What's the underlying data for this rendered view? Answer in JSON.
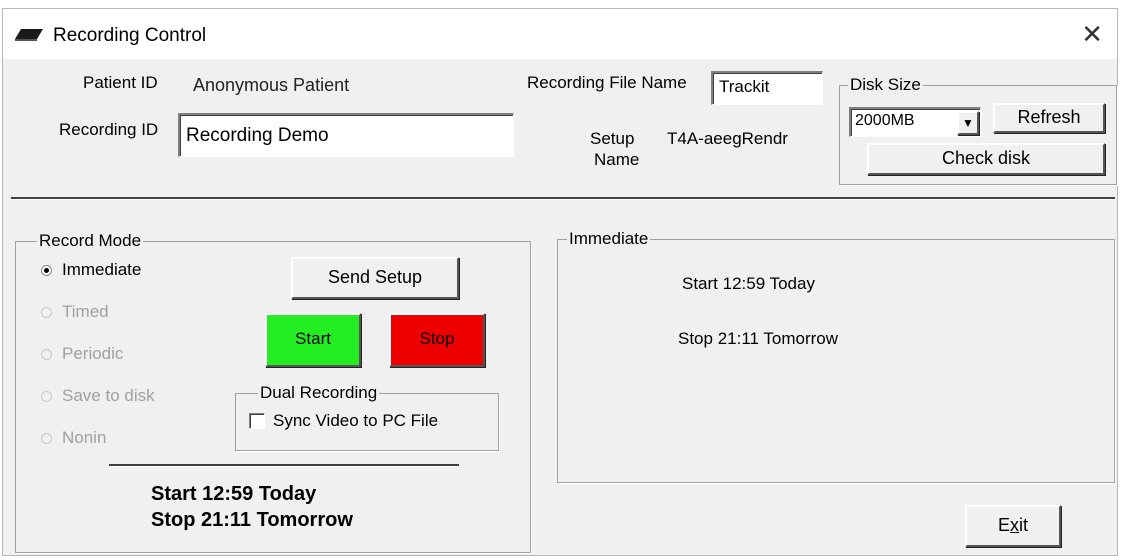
{
  "window": {
    "title": "Recording Control",
    "close_glyph": "✕"
  },
  "patient": {
    "label": "Patient ID",
    "value": "Anonymous Patient"
  },
  "recording_id": {
    "label": "Recording ID",
    "value": "Recording Demo"
  },
  "recording_file": {
    "label": "Recording File Name",
    "value": "Trackit"
  },
  "setup_name": {
    "label_line1": "Setup",
    "label_line2": "Name",
    "value": "T4A-aeegRendr"
  },
  "disk_size": {
    "group_title": "Disk Size",
    "selected": "2000MB",
    "dropdown_arrow": "▼",
    "refresh_label": "Refresh",
    "check_disk_label": "Check disk"
  },
  "record_mode": {
    "group_title": "Record Mode",
    "options": [
      {
        "label": "Immediate",
        "checked": true,
        "enabled": true
      },
      {
        "label": "Timed",
        "checked": false,
        "enabled": false
      },
      {
        "label": "Periodic",
        "checked": false,
        "enabled": false
      },
      {
        "label": "Save to disk",
        "checked": false,
        "enabled": false
      },
      {
        "label": "Nonin",
        "checked": false,
        "enabled": false
      }
    ],
    "send_setup_label": "Send Setup",
    "start_label": "Start",
    "stop_label": "Stop",
    "start_color": "#22ee22",
    "stop_color": "#ee0000",
    "dual_recording": {
      "group_title": "Dual Recording",
      "checkbox_label": "Sync Video to PC File",
      "checked": false
    },
    "status_line1": "Start 12:59 Today",
    "status_line2": "Stop 21:11 Tomorrow"
  },
  "immediate_panel": {
    "group_title": "Immediate",
    "start_text": "Start 12:59 Today",
    "stop_text": "Stop 21:11  Tomorrow"
  },
  "exit": {
    "label_prefix": "E",
    "label_mnemonic": "x",
    "label_suffix": "it"
  }
}
